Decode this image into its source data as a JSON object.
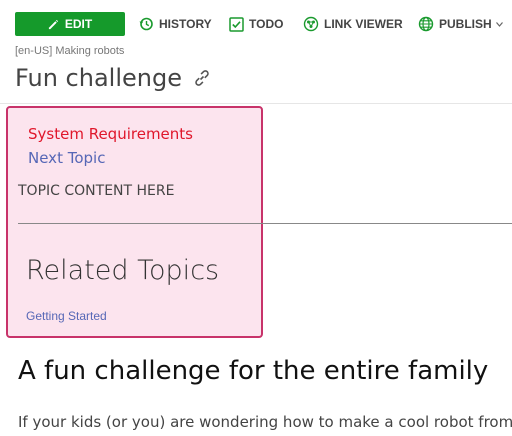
{
  "toolbar": {
    "edit_label": "EDIT",
    "history_label": "HISTORY",
    "todo_label": "TODO",
    "link_viewer_label": "LINK VIEWER",
    "publish_label": "PUBLISH",
    "edit_color": "#159a2b"
  },
  "breadcrumb": "[en-US] Making robots",
  "page": {
    "title": "Fun challenge"
  },
  "topic_box": {
    "links": [
      "System Requirements",
      "Next Topic"
    ],
    "content": "TOPIC CONTENT HERE",
    "related_heading": "Related Topics",
    "related_links": [
      "Getting Started"
    ],
    "border_color": "#c8336a",
    "background_color": "#fce4ee"
  },
  "article": {
    "heading": "A fun challenge for the entire family",
    "paragraph": "If your kids (or you) are wondering how to make a cool robot from"
  }
}
